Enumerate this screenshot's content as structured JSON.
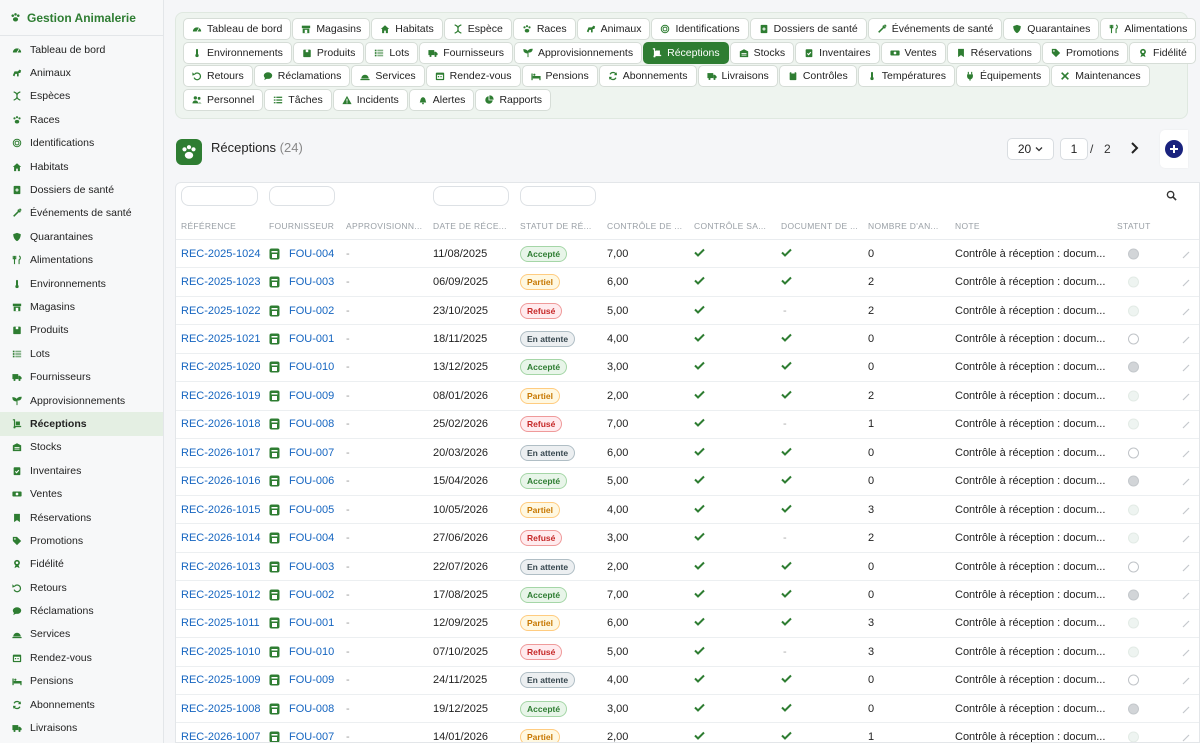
{
  "app": {
    "title": "Gestion Animalerie"
  },
  "sidebar": {
    "items": [
      {
        "label": "Tableau de bord",
        "icon": "dashboard-icon"
      },
      {
        "label": "Animaux",
        "icon": "animal-icon"
      },
      {
        "label": "Espèces",
        "icon": "dna-icon"
      },
      {
        "label": "Races",
        "icon": "paw-icon"
      },
      {
        "label": "Identifications",
        "icon": "fingerprint-icon"
      },
      {
        "label": "Habitats",
        "icon": "home-icon"
      },
      {
        "label": "Dossiers de santé",
        "icon": "medical-file-icon"
      },
      {
        "label": "Événements de santé",
        "icon": "syringe-icon"
      },
      {
        "label": "Quarantaines",
        "icon": "shield-icon"
      },
      {
        "label": "Alimentations",
        "icon": "utensils-icon"
      },
      {
        "label": "Environnements",
        "icon": "thermometer-icon"
      },
      {
        "label": "Magasins",
        "icon": "store-icon"
      },
      {
        "label": "Produits",
        "icon": "box-icon"
      },
      {
        "label": "Lots",
        "icon": "list-icon"
      },
      {
        "label": "Fournisseurs",
        "icon": "truck-icon"
      },
      {
        "label": "Approvisionnements",
        "icon": "seedling-icon"
      },
      {
        "label": "Réceptions",
        "icon": "dolly-icon",
        "active": true
      },
      {
        "label": "Stocks",
        "icon": "warehouse-icon"
      },
      {
        "label": "Inventaires",
        "icon": "clipboard-check-icon"
      },
      {
        "label": "Ventes",
        "icon": "cash-icon"
      },
      {
        "label": "Réservations",
        "icon": "bookmark-icon"
      },
      {
        "label": "Promotions",
        "icon": "tag-icon"
      },
      {
        "label": "Fidélité",
        "icon": "award-icon"
      },
      {
        "label": "Retours",
        "icon": "undo-icon"
      },
      {
        "label": "Réclamations",
        "icon": "comment-icon"
      },
      {
        "label": "Services",
        "icon": "bell-concierge-icon"
      },
      {
        "label": "Rendez-vous",
        "icon": "calendar-icon"
      },
      {
        "label": "Pensions",
        "icon": "bed-icon"
      },
      {
        "label": "Abonnements",
        "icon": "sync-icon"
      },
      {
        "label": "Livraisons",
        "icon": "shipping-icon"
      }
    ]
  },
  "topnav": {
    "rows": [
      [
        {
          "label": "Tableau de bord",
          "icon": "dashboard-icon"
        },
        {
          "label": "Magasins",
          "icon": "store-icon"
        },
        {
          "label": "Habitats",
          "icon": "home-icon"
        },
        {
          "label": "Espèce",
          "icon": "dna-icon"
        },
        {
          "label": "Races",
          "icon": "paw-icon"
        },
        {
          "label": "Animaux",
          "icon": "animal-icon"
        },
        {
          "label": "Identifications",
          "icon": "fingerprint-icon"
        },
        {
          "label": "Dossiers de santé",
          "icon": "medical-file-icon"
        },
        {
          "label": "Événements de santé",
          "icon": "syringe-icon"
        },
        {
          "label": "Quarantaines",
          "icon": "shield-icon"
        },
        {
          "label": "Alimentations",
          "icon": "utensils-icon"
        }
      ],
      [
        {
          "label": "Environnements",
          "icon": "thermometer-icon"
        },
        {
          "label": "Produits",
          "icon": "box-icon"
        },
        {
          "label": "Lots",
          "icon": "list-icon"
        },
        {
          "label": "Fournisseurs",
          "icon": "truck-icon"
        },
        {
          "label": "Approvisionnements",
          "icon": "seedling-icon"
        },
        {
          "label": "Réceptions",
          "icon": "dolly-icon",
          "active": true
        },
        {
          "label": "Stocks",
          "icon": "warehouse-icon"
        },
        {
          "label": "Inventaires",
          "icon": "clipboard-check-icon"
        },
        {
          "label": "Ventes",
          "icon": "cash-icon"
        },
        {
          "label": "Réservations",
          "icon": "bookmark-icon"
        },
        {
          "label": "Promotions",
          "icon": "tag-icon"
        },
        {
          "label": "Fidélité",
          "icon": "award-icon"
        }
      ],
      [
        {
          "label": "Retours",
          "icon": "undo-icon"
        },
        {
          "label": "Réclamations",
          "icon": "comment-icon"
        },
        {
          "label": "Services",
          "icon": "bell-concierge-icon"
        },
        {
          "label": "Rendez-vous",
          "icon": "calendar-icon"
        },
        {
          "label": "Pensions",
          "icon": "bed-icon"
        },
        {
          "label": "Abonnements",
          "icon": "sync-icon"
        },
        {
          "label": "Livraisons",
          "icon": "shipping-icon"
        },
        {
          "label": "Contrôles",
          "icon": "clipboard-icon"
        },
        {
          "label": "Températures",
          "icon": "thermometer-icon"
        },
        {
          "label": "Équipements",
          "icon": "plug-icon"
        },
        {
          "label": "Maintenances",
          "icon": "tools-icon"
        }
      ],
      [
        {
          "label": "Personnel",
          "icon": "users-icon"
        },
        {
          "label": "Tâches",
          "icon": "tasks-icon"
        },
        {
          "label": "Incidents",
          "icon": "warning-icon"
        },
        {
          "label": "Alertes",
          "icon": "bell-icon"
        },
        {
          "label": "Rapports",
          "icon": "pie-chart-icon"
        }
      ]
    ]
  },
  "header": {
    "title": "Réceptions",
    "count": "(24)"
  },
  "pagination": {
    "per_page": "20",
    "current": "1",
    "separator": "/",
    "total": "2"
  },
  "table": {
    "columns": [
      "RÉFÉRENCE",
      "FOURNISSEUR",
      "APPROVISIONN...",
      "DATE DE RÉCE...",
      "STATUT DE RÉ...",
      "CONTRÔLE DE ...",
      "CONTRÔLE SA...",
      "DOCUMENT DE ...",
      "NOMBRE D'AN...",
      "NOTE",
      "STATUT"
    ],
    "rows": [
      {
        "ref": "REC-2025-1024",
        "fou": "FOU-004",
        "app": "-",
        "date": "11/08/2025",
        "statut": "Accepté",
        "ctrl": "7,00",
        "sa": true,
        "doc": true,
        "nb": "0",
        "note": "Contrôle à réception : docum...",
        "st": "gray"
      },
      {
        "ref": "REC-2025-1023",
        "fou": "FOU-003",
        "app": "-",
        "date": "06/09/2025",
        "statut": "Partiel",
        "ctrl": "6,00",
        "sa": true,
        "doc": true,
        "nb": "2",
        "note": "Contrôle à réception : docum...",
        "st": "light"
      },
      {
        "ref": "REC-2025-1022",
        "fou": "FOU-002",
        "app": "-",
        "date": "23/10/2025",
        "statut": "Refusé",
        "ctrl": "5,00",
        "sa": true,
        "doc": false,
        "nb": "2",
        "note": "Contrôle à réception : docum...",
        "st": "light"
      },
      {
        "ref": "REC-2025-1021",
        "fou": "FOU-001",
        "app": "-",
        "date": "18/11/2025",
        "statut": "En attente",
        "ctrl": "4,00",
        "sa": true,
        "doc": true,
        "nb": "0",
        "note": "Contrôle à réception : docum...",
        "st": "open"
      },
      {
        "ref": "REC-2025-1020",
        "fou": "FOU-010",
        "app": "-",
        "date": "13/12/2025",
        "statut": "Accepté",
        "ctrl": "3,00",
        "sa": true,
        "doc": true,
        "nb": "0",
        "note": "Contrôle à réception : docum...",
        "st": "gray"
      },
      {
        "ref": "REC-2026-1019",
        "fou": "FOU-009",
        "app": "-",
        "date": "08/01/2026",
        "statut": "Partiel",
        "ctrl": "2,00",
        "sa": true,
        "doc": true,
        "nb": "2",
        "note": "Contrôle à réception : docum...",
        "st": "light"
      },
      {
        "ref": "REC-2026-1018",
        "fou": "FOU-008",
        "app": "-",
        "date": "25/02/2026",
        "statut": "Refusé",
        "ctrl": "7,00",
        "sa": true,
        "doc": false,
        "nb": "1",
        "note": "Contrôle à réception : docum...",
        "st": "light"
      },
      {
        "ref": "REC-2026-1017",
        "fou": "FOU-007",
        "app": "-",
        "date": "20/03/2026",
        "statut": "En attente",
        "ctrl": "6,00",
        "sa": true,
        "doc": true,
        "nb": "0",
        "note": "Contrôle à réception : docum...",
        "st": "open"
      },
      {
        "ref": "REC-2026-1016",
        "fou": "FOU-006",
        "app": "-",
        "date": "15/04/2026",
        "statut": "Accepté",
        "ctrl": "5,00",
        "sa": true,
        "doc": true,
        "nb": "0",
        "note": "Contrôle à réception : docum...",
        "st": "gray"
      },
      {
        "ref": "REC-2026-1015",
        "fou": "FOU-005",
        "app": "-",
        "date": "10/05/2026",
        "statut": "Partiel",
        "ctrl": "4,00",
        "sa": true,
        "doc": true,
        "nb": "3",
        "note": "Contrôle à réception : docum...",
        "st": "light"
      },
      {
        "ref": "REC-2026-1014",
        "fou": "FOU-004",
        "app": "-",
        "date": "27/06/2026",
        "statut": "Refusé",
        "ctrl": "3,00",
        "sa": true,
        "doc": false,
        "nb": "2",
        "note": "Contrôle à réception : docum...",
        "st": "light"
      },
      {
        "ref": "REC-2026-1013",
        "fou": "FOU-003",
        "app": "-",
        "date": "22/07/2026",
        "statut": "En attente",
        "ctrl": "2,00",
        "sa": true,
        "doc": true,
        "nb": "0",
        "note": "Contrôle à réception : docum...",
        "st": "open"
      },
      {
        "ref": "REC-2025-1012",
        "fou": "FOU-002",
        "app": "-",
        "date": "17/08/2025",
        "statut": "Accepté",
        "ctrl": "7,00",
        "sa": true,
        "doc": true,
        "nb": "0",
        "note": "Contrôle à réception : docum...",
        "st": "gray"
      },
      {
        "ref": "REC-2025-1011",
        "fou": "FOU-001",
        "app": "-",
        "date": "12/09/2025",
        "statut": "Partiel",
        "ctrl": "6,00",
        "sa": true,
        "doc": true,
        "nb": "3",
        "note": "Contrôle à réception : docum...",
        "st": "light"
      },
      {
        "ref": "REC-2025-1010",
        "fou": "FOU-010",
        "app": "-",
        "date": "07/10/2025",
        "statut": "Refusé",
        "ctrl": "5,00",
        "sa": true,
        "doc": false,
        "nb": "3",
        "note": "Contrôle à réception : docum...",
        "st": "light"
      },
      {
        "ref": "REC-2025-1009",
        "fou": "FOU-009",
        "app": "-",
        "date": "24/11/2025",
        "statut": "En attente",
        "ctrl": "4,00",
        "sa": true,
        "doc": true,
        "nb": "0",
        "note": "Contrôle à réception : docum...",
        "st": "open"
      },
      {
        "ref": "REC-2025-1008",
        "fou": "FOU-008",
        "app": "-",
        "date": "19/12/2025",
        "statut": "Accepté",
        "ctrl": "3,00",
        "sa": true,
        "doc": true,
        "nb": "0",
        "note": "Contrôle à réception : docum...",
        "st": "gray"
      },
      {
        "ref": "REC-2026-1007",
        "fou": "FOU-007",
        "app": "-",
        "date": "14/01/2026",
        "statut": "Partiel",
        "ctrl": "2,00",
        "sa": true,
        "doc": true,
        "nb": "1",
        "note": "Contrôle à réception : docum...",
        "st": "light"
      }
    ]
  },
  "colors": {
    "accent": "#2e7d32",
    "link": "#1565c0",
    "add": "#1a237e"
  }
}
